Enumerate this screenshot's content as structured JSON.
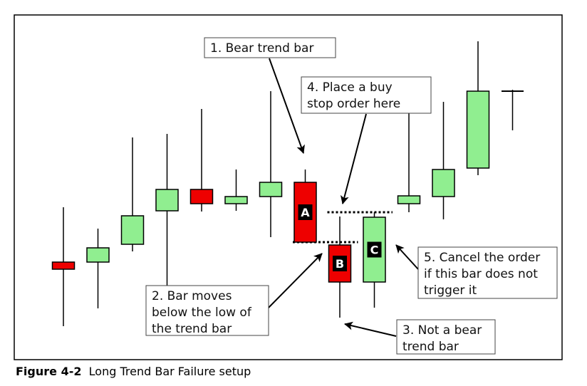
{
  "figure": {
    "caption_label": "Figure 4-2",
    "caption_text": "Long Trend Bar Failure setup"
  },
  "chart_data": {
    "type": "candlestick",
    "colors": {
      "bull": "#90ee90",
      "bear": "#ee0000",
      "outline": "#000000"
    },
    "bars": [
      {
        "open": 24.0,
        "high": 31.7,
        "low": 15.0,
        "close": 23.0
      },
      {
        "open": 24.0,
        "high": 28.7,
        "low": 17.5,
        "close": 26.0
      },
      {
        "open": 26.5,
        "high": 41.5,
        "low": 25.5,
        "close": 30.5
      },
      {
        "open": 31.2,
        "high": 42.0,
        "low": 20.2,
        "close": 34.2
      },
      {
        "open": 34.2,
        "high": 45.5,
        "low": 31.1,
        "close": 32.2
      },
      {
        "open": 32.2,
        "high": 37.0,
        "low": 31.2,
        "close": 33.2
      },
      {
        "open": 33.2,
        "high": 48.0,
        "low": 27.5,
        "close": 35.2
      },
      {
        "open": 35.2,
        "high": 37.0,
        "low": 26.8,
        "close": 26.8,
        "label": "A"
      },
      {
        "open": 26.4,
        "high": 30.4,
        "low": 16.2,
        "close": 21.2,
        "label": "B"
      },
      {
        "open": 21.2,
        "high": 31.0,
        "low": 17.6,
        "close": 30.3,
        "label": "C"
      },
      {
        "open": 32.2,
        "high": 45.0,
        "low": 31.0,
        "close": 33.3
      },
      {
        "open": 33.2,
        "high": 46.5,
        "low": 30.0,
        "close": 37.0
      },
      {
        "open": 37.2,
        "high": 55.0,
        "low": 36.2,
        "close": 48.0
      },
      {
        "open": 48.0,
        "high": 48.2,
        "low": 42.5,
        "close": 48.0
      }
    ],
    "levels": [
      {
        "name": "trend-bar-low-line",
        "value": 26.8,
        "from": 7,
        "to": 8
      },
      {
        "name": "buy-stop-line",
        "value": 31.0,
        "from": 8,
        "to": 9
      }
    ],
    "annotations": [
      {
        "name": "callout-1",
        "lines": [
          "1. Bear trend bar"
        ]
      },
      {
        "name": "callout-4",
        "lines": [
          "4. Place a buy",
          "stop order here"
        ]
      },
      {
        "name": "callout-2",
        "lines": [
          "2. Bar moves",
          "below the low of",
          "the trend bar"
        ]
      },
      {
        "name": "callout-5",
        "lines": [
          "5. Cancel the order",
          "if this bar does not",
          "trigger it"
        ]
      },
      {
        "name": "callout-3",
        "lines": [
          "3. Not a bear",
          "trend bar"
        ]
      }
    ]
  }
}
